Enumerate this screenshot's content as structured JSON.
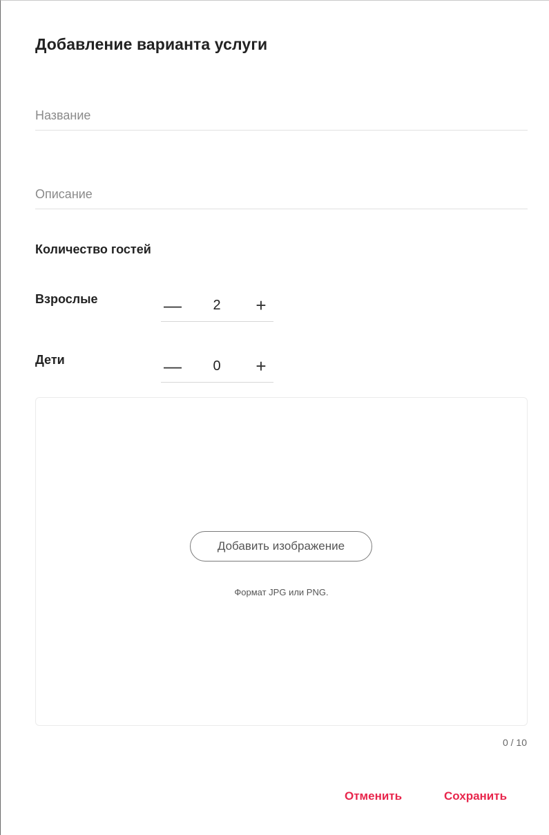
{
  "dialog": {
    "title": "Добавление варианта услуги"
  },
  "fields": {
    "name_placeholder": "Название",
    "description_placeholder": "Описание"
  },
  "guests": {
    "section_label": "Количество гостей",
    "adults": {
      "label": "Взрослые",
      "value": "2",
      "minus": "—",
      "plus": "+"
    },
    "children": {
      "label": "Дети",
      "value": "0",
      "minus": "—",
      "plus": "+"
    }
  },
  "images": {
    "add_button_label": "Добавить изображение",
    "format_hint": "Формат JPG или PNG.",
    "counter": "0 / 10"
  },
  "actions": {
    "cancel_label": "Отменить",
    "save_label": "Сохранить"
  },
  "colors": {
    "accent": "#e8264c",
    "text_primary": "#222222",
    "placeholder": "#8a8a8a"
  }
}
